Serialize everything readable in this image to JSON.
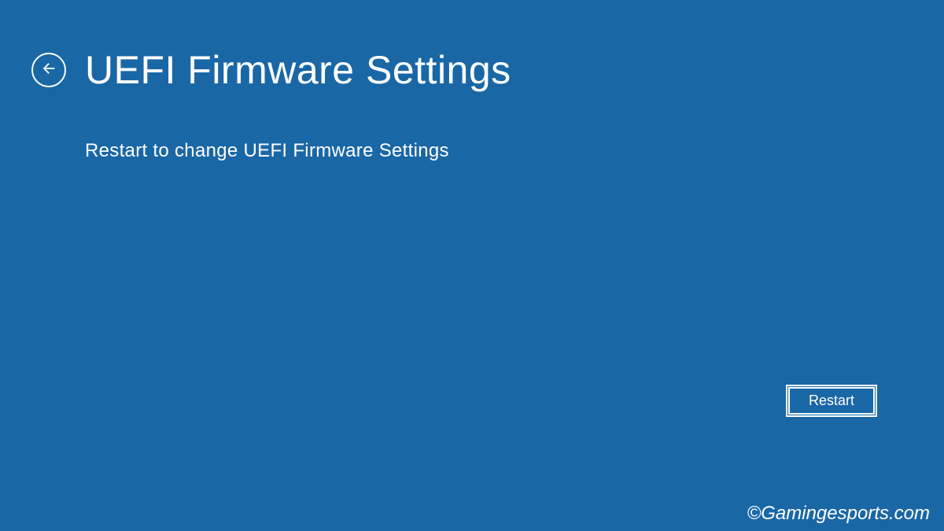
{
  "header": {
    "title": "UEFI Firmware Settings"
  },
  "main": {
    "description": "Restart to change UEFI Firmware Settings"
  },
  "actions": {
    "restart_label": "Restart"
  },
  "watermark": "©Gamingesports.com"
}
